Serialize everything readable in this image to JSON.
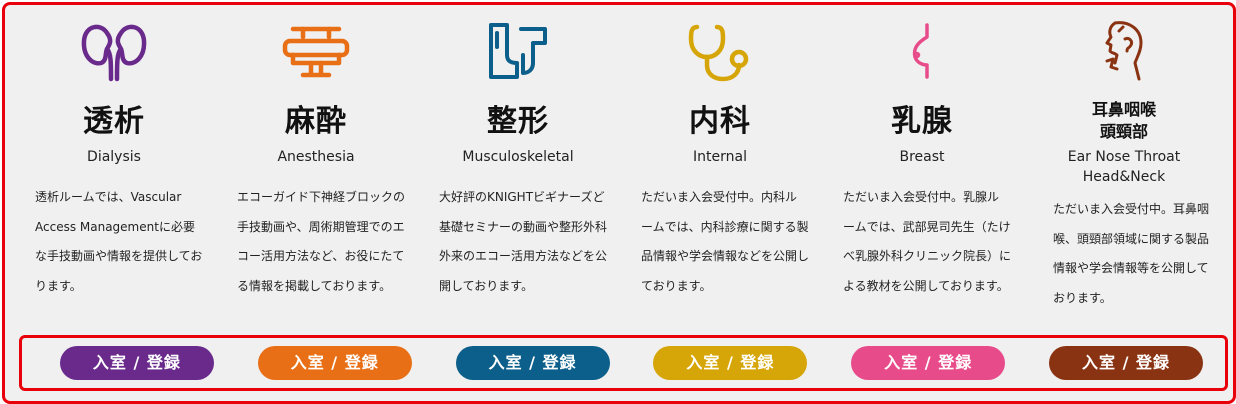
{
  "colors": {
    "dialysis": "#6a2a8c",
    "anesthesia": "#e86f15",
    "musculoskeletal": "#0b5f8a",
    "internal": "#d6a508",
    "breast": "#e84b8a",
    "ent": "#8a3312",
    "frame": "#e8000b"
  },
  "departments": [
    {
      "icon": "kidneys-icon",
      "title": "透析",
      "subtitle": "Dialysis",
      "description": "透析ルームでは、Vascular Access Managementに必要な手技動画や情報を提供しております。",
      "button": "入室 / 登録"
    },
    {
      "icon": "surgery-table-icon",
      "title": "麻酔",
      "subtitle": "Anesthesia",
      "description": "エコーガイド下神経ブロックの手技動画や、周術期管理でのエコー活用方法など、お役にたてる情報を掲載しております。",
      "button": "入室 / 登録"
    },
    {
      "icon": "knee-joint-icon",
      "title": "整形",
      "subtitle": "Musculoskeletal",
      "description": "大好評のKNIGHTビギナーズど基礎セミナーの動画や整形外科外来のエコー活用方法などを公開しております。",
      "button": "入室 / 登録"
    },
    {
      "icon": "stethoscope-icon",
      "title": "内科",
      "subtitle": "Internal",
      "description": "ただいま入会受付中。内科ルームでは、内科診療に関する製品情報や学会情報などを公開しております。",
      "button": "入室 / 登録"
    },
    {
      "icon": "breast-icon",
      "title": "乳腺",
      "subtitle": "Breast",
      "description": "ただいま入会受付中。乳腺ルームでは、武部晃司先生（たけべ乳腺外科クリニック院長）による教材を公開しております。",
      "button": "入室 / 登録"
    },
    {
      "icon": "head-neck-icon",
      "title_line1": "耳鼻咽喉",
      "title_line2": "頭頸部",
      "subtitle_line1": "Ear Nose Throat",
      "subtitle_line2": "Head&Neck",
      "description": "ただいま入会受付中。耳鼻咽喉、頭頸部領域に関する製品情報や学会情報等を公開しております。",
      "button": "入室 / 登録"
    }
  ]
}
